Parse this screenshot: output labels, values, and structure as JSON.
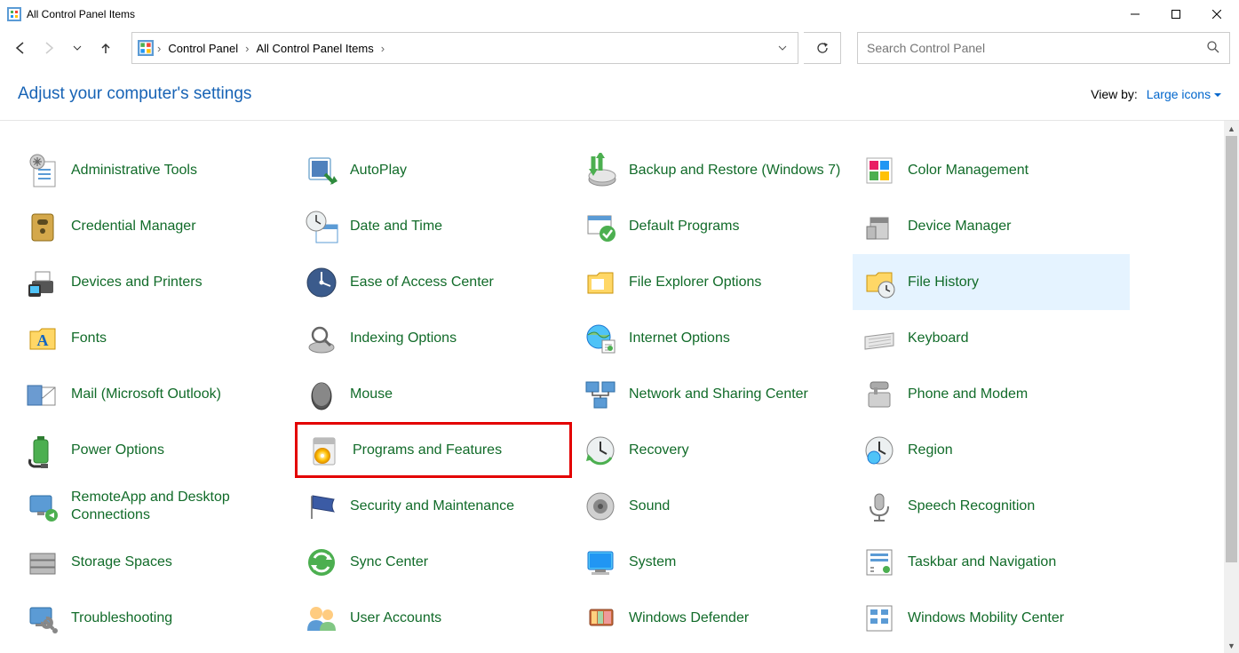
{
  "window": {
    "title": "All Control Panel Items"
  },
  "breadcrumb": {
    "seg1": "Control Panel",
    "seg2": "All Control Panel Items"
  },
  "search": {
    "placeholder": "Search Control Panel"
  },
  "header": {
    "heading": "Adjust your computer's settings",
    "viewby_label": "View by:",
    "viewby_value": "Large icons"
  },
  "items": [
    {
      "label": "Administrative Tools",
      "icon": "admin-tools-icon"
    },
    {
      "label": "AutoPlay",
      "icon": "autoplay-icon"
    },
    {
      "label": "Backup and Restore (Windows 7)",
      "icon": "backup-icon"
    },
    {
      "label": "Color Management",
      "icon": "color-icon"
    },
    {
      "label": "Credential Manager",
      "icon": "credential-icon"
    },
    {
      "label": "Date and Time",
      "icon": "datetime-icon"
    },
    {
      "label": "Default Programs",
      "icon": "defaults-icon"
    },
    {
      "label": "Device Manager",
      "icon": "devicemgr-icon"
    },
    {
      "label": "Devices and Printers",
      "icon": "devprint-icon"
    },
    {
      "label": "Ease of Access Center",
      "icon": "ease-icon"
    },
    {
      "label": "File Explorer Options",
      "icon": "fileexp-icon"
    },
    {
      "label": "File History",
      "icon": "filehist-icon",
      "hover": true
    },
    {
      "label": "Fonts",
      "icon": "fonts-icon"
    },
    {
      "label": "Indexing Options",
      "icon": "indexing-icon"
    },
    {
      "label": "Internet Options",
      "icon": "internet-icon"
    },
    {
      "label": "Keyboard",
      "icon": "keyboard-icon"
    },
    {
      "label": "Mail (Microsoft Outlook)",
      "icon": "mail-icon"
    },
    {
      "label": "Mouse",
      "icon": "mouse-icon"
    },
    {
      "label": "Network and Sharing Center",
      "icon": "network-icon"
    },
    {
      "label": "Phone and Modem",
      "icon": "phone-icon"
    },
    {
      "label": "Power Options",
      "icon": "power-icon"
    },
    {
      "label": "Programs and Features",
      "icon": "programs-icon",
      "boxed": true
    },
    {
      "label": "Recovery",
      "icon": "recovery-icon"
    },
    {
      "label": "Region",
      "icon": "region-icon"
    },
    {
      "label": "RemoteApp and Desktop Connections",
      "icon": "remoteapp-icon"
    },
    {
      "label": "Security and Maintenance",
      "icon": "security-icon"
    },
    {
      "label": "Sound",
      "icon": "sound-icon"
    },
    {
      "label": "Speech Recognition",
      "icon": "speech-icon"
    },
    {
      "label": "Storage Spaces",
      "icon": "storage-icon"
    },
    {
      "label": "Sync Center",
      "icon": "sync-icon"
    },
    {
      "label": "System",
      "icon": "system-icon"
    },
    {
      "label": "Taskbar and Navigation",
      "icon": "taskbar-icon"
    },
    {
      "label": "Troubleshooting",
      "icon": "troubleshoot-icon"
    },
    {
      "label": "User Accounts",
      "icon": "users-icon"
    },
    {
      "label": "Windows Defender",
      "icon": "defender-icon"
    },
    {
      "label": "Windows Mobility Center",
      "icon": "mobility-icon"
    }
  ]
}
